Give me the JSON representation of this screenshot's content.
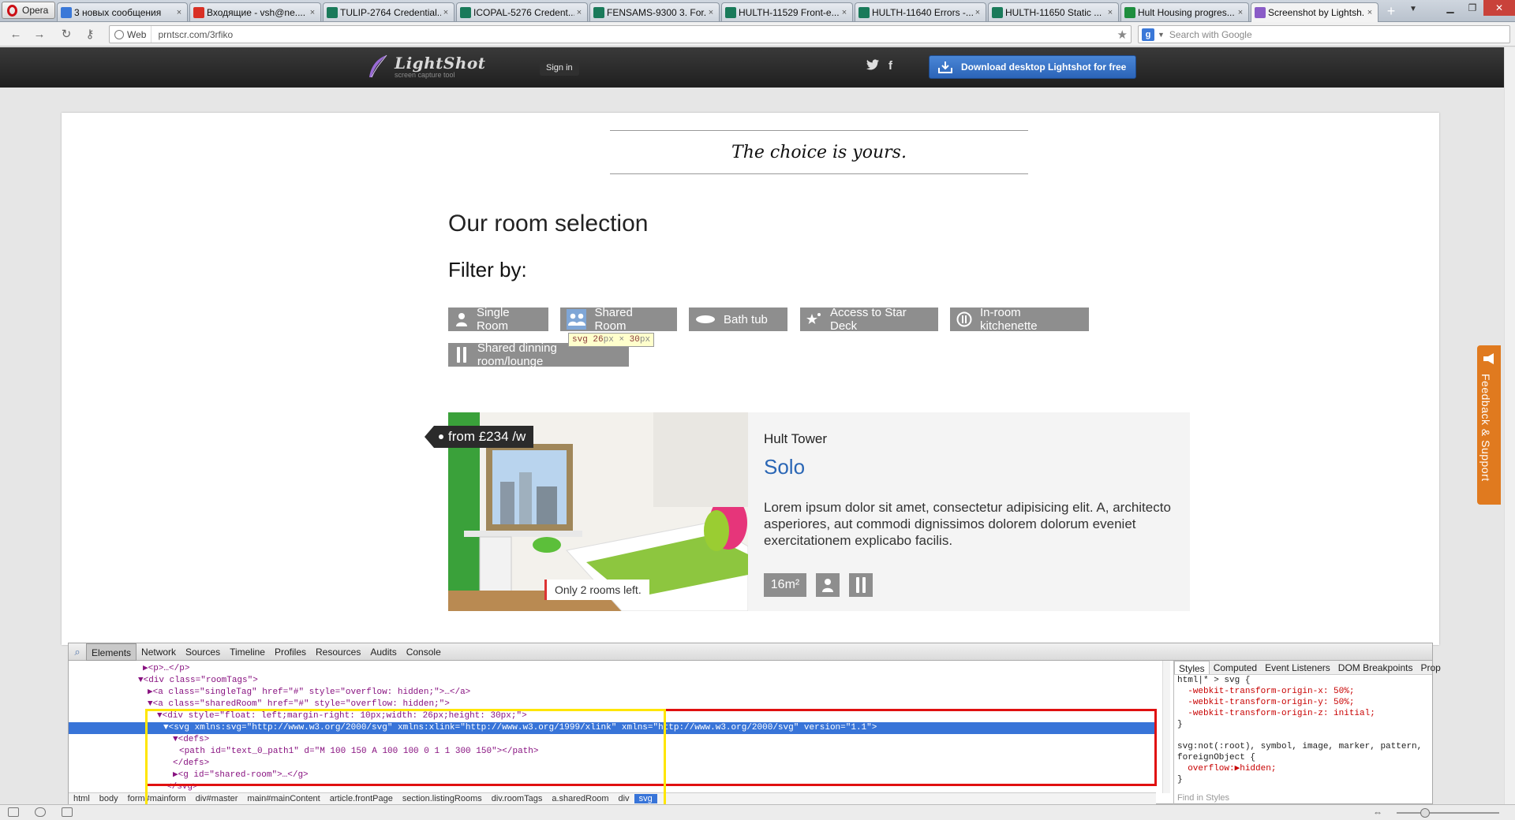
{
  "browser": {
    "menu_label": "Opera",
    "tabs": [
      {
        "title": "3 новых сообщения",
        "icon": "email-icon",
        "color": "#3a78d8"
      },
      {
        "title": "Входящие - vsh@ne....",
        "icon": "gmail-icon",
        "color": "#d93025"
      },
      {
        "title": "TULIP-2764 Credential...",
        "icon": "jira-icon",
        "color": "#1a7a5a"
      },
      {
        "title": "ICOPAL-5276 Credent...",
        "icon": "jira-icon",
        "color": "#1a7a5a"
      },
      {
        "title": "FENSAMS-9300 3. For...",
        "icon": "jira-icon",
        "color": "#1a7a5a"
      },
      {
        "title": "HULTH-11529 Front-e...",
        "icon": "jira-icon",
        "color": "#1a7a5a"
      },
      {
        "title": "HULTH-11640 Errors -...",
        "icon": "jira-icon",
        "color": "#1a7a5a"
      },
      {
        "title": "HULTH-11650 Static ...",
        "icon": "jira-icon",
        "color": "#1a7a5a"
      },
      {
        "title": "Hult Housing progres...",
        "icon": "spreadsheet-icon",
        "color": "#1e8e3e"
      },
      {
        "title": "Screenshot by Lightsh...",
        "icon": "lightshot-feather-icon",
        "color": "#8a5cc7",
        "active": true
      }
    ],
    "address": {
      "chip": "Web",
      "url": "prntscr.com/3rfiko"
    },
    "search": {
      "placeholder": "Search with Google",
      "engine_letter": "g"
    }
  },
  "site_header": {
    "logo_name": "LightShot",
    "logo_sub": "screen capture tool",
    "signin": "Sign in",
    "download": "Download desktop Lightshot for free"
  },
  "page": {
    "tagline": "The choice is yours.",
    "rooms_title": "Our room selection",
    "filter_title": "Filter by:",
    "filters": [
      {
        "label": "Single Room",
        "icon": "person-icon"
      },
      {
        "label": "Shared Room",
        "icon": "two-people-icon"
      },
      {
        "label": "Bath tub",
        "icon": "bathtub-icon"
      },
      {
        "label": "Access to Star Deck",
        "icon": "star-deck-icon"
      },
      {
        "label": "In-room kitchenette",
        "icon": "kitchenette-icon"
      },
      {
        "label": "Shared dinning room/lounge",
        "icon": "fork-knife-icon"
      }
    ],
    "tooltip": {
      "tag": "svg",
      "width": "26",
      "height": "30",
      "unit": "px",
      "times": "×"
    },
    "card": {
      "price": "from £234 /w",
      "rooms_left": "Only 2 rooms left.",
      "hall": "Hult Tower",
      "room_name": "Solo",
      "description": "Lorem ipsum dolor sit amet, consectetur adipisicing elit. A, architecto asperiores, aut commodi dignissimos dolorem dolorum eveniet exercitationem explicabo facilis.",
      "area": "16m²",
      "features": [
        "person-icon",
        "fork-knife-icon"
      ]
    }
  },
  "devtools": {
    "tabs": [
      "Elements",
      "Network",
      "Sources",
      "Timeline",
      "Profiles",
      "Resources",
      "Audits",
      "Console"
    ],
    "dom_lines": [
      "▶<p>…</p>",
      "▼<div class=\"roomTags\">",
      "▶<a class=\"singleTag\" href=\"#\" style=\"overflow: hidden;\">…</a>",
      "▼<a class=\"sharedRoom\" href=\"#\" style=\"overflow: hidden;\">",
      "▼<div style=\"float: left;margin-right: 10px;width: 26px;height: 30px;\">",
      "▼<svg xmlns:svg=\"http://www.w3.org/2000/svg\" xmlns:xlink=\"http://www.w3.org/1999/xlink\" xmlns=\"http://www.w3.org/2000/svg\" version=\"1.1\">",
      "▼<defs>",
      "<path id=\"text_0_path1\" d=\"M 100 150 A 100 100 0 1 1 300 150\"></path>",
      "</defs>",
      "▶<g id=\"shared-room\">…</g>",
      "</svg>"
    ],
    "breadcrumbs": [
      "html",
      "body",
      "form#mainform",
      "div#master",
      "main#mainContent",
      "article.frontPage",
      "section.listingRooms",
      "div.roomTags",
      "a.sharedRoom",
      "div",
      "svg"
    ],
    "side_tabs": [
      "Styles",
      "Computed",
      "Event Listeners",
      "DOM Breakpoints",
      "Prop"
    ],
    "css_lines": [
      "html|* > svg {",
      "  -webkit-transform-origin-x: 50%;",
      "  -webkit-transform-origin-y: 50%;",
      "  -webkit-transform-origin-z: initial;",
      "}",
      "",
      "svg:not(:root), symbol, image, marker, pattern,",
      "foreignObject {",
      "  overflow:▶hidden;",
      "}"
    ],
    "find_placeholder": "Find in Styles"
  },
  "feedback": {
    "label": "Feedback & Support"
  },
  "colors": {
    "accent": "#2a66b5",
    "highlight_yellow": "#ffe600",
    "highlight_red": "#e01010",
    "feedback_orange": "#e07a1f"
  }
}
